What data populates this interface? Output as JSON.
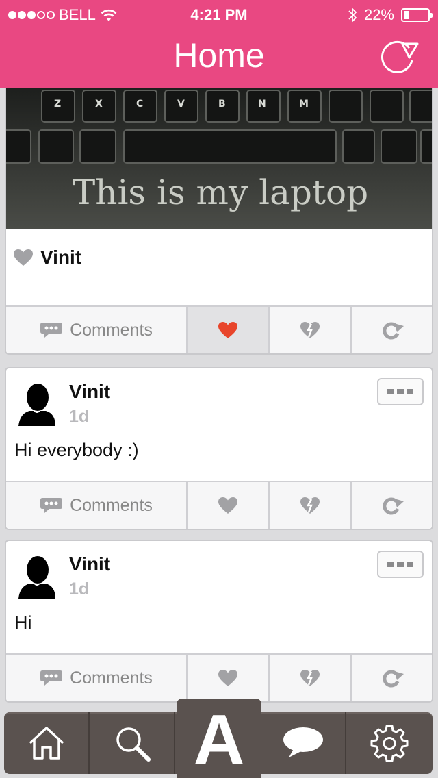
{
  "status_bar": {
    "carrier": "BELL",
    "time": "4:21 PM",
    "battery": "22%",
    "battery_level": 0.22
  },
  "header": {
    "title": "Home",
    "refresh_icon": "refresh-icon"
  },
  "posts": [
    {
      "image_caption": "This is my laptop",
      "liked_by": "Vinit",
      "liked": true,
      "actions": {
        "comments_label": "Comments"
      }
    },
    {
      "author": "Vinit",
      "time": "1d",
      "text": "Hi everybody :)",
      "liked": false,
      "actions": {
        "comments_label": "Comments"
      }
    },
    {
      "author": "Vinit",
      "time": "1d",
      "text": "Hi",
      "liked": false,
      "actions": {
        "comments_label": "Comments"
      }
    }
  ],
  "tabbar": {
    "items": [
      "home-icon",
      "search-icon",
      "app-logo",
      "chat-icon",
      "gear-icon"
    ],
    "center_label": "A"
  },
  "colors": {
    "header": "#e94882",
    "like_active": "#e8452b",
    "icon_gray": "#a2a2a5",
    "tabbar": "#5a524f"
  }
}
